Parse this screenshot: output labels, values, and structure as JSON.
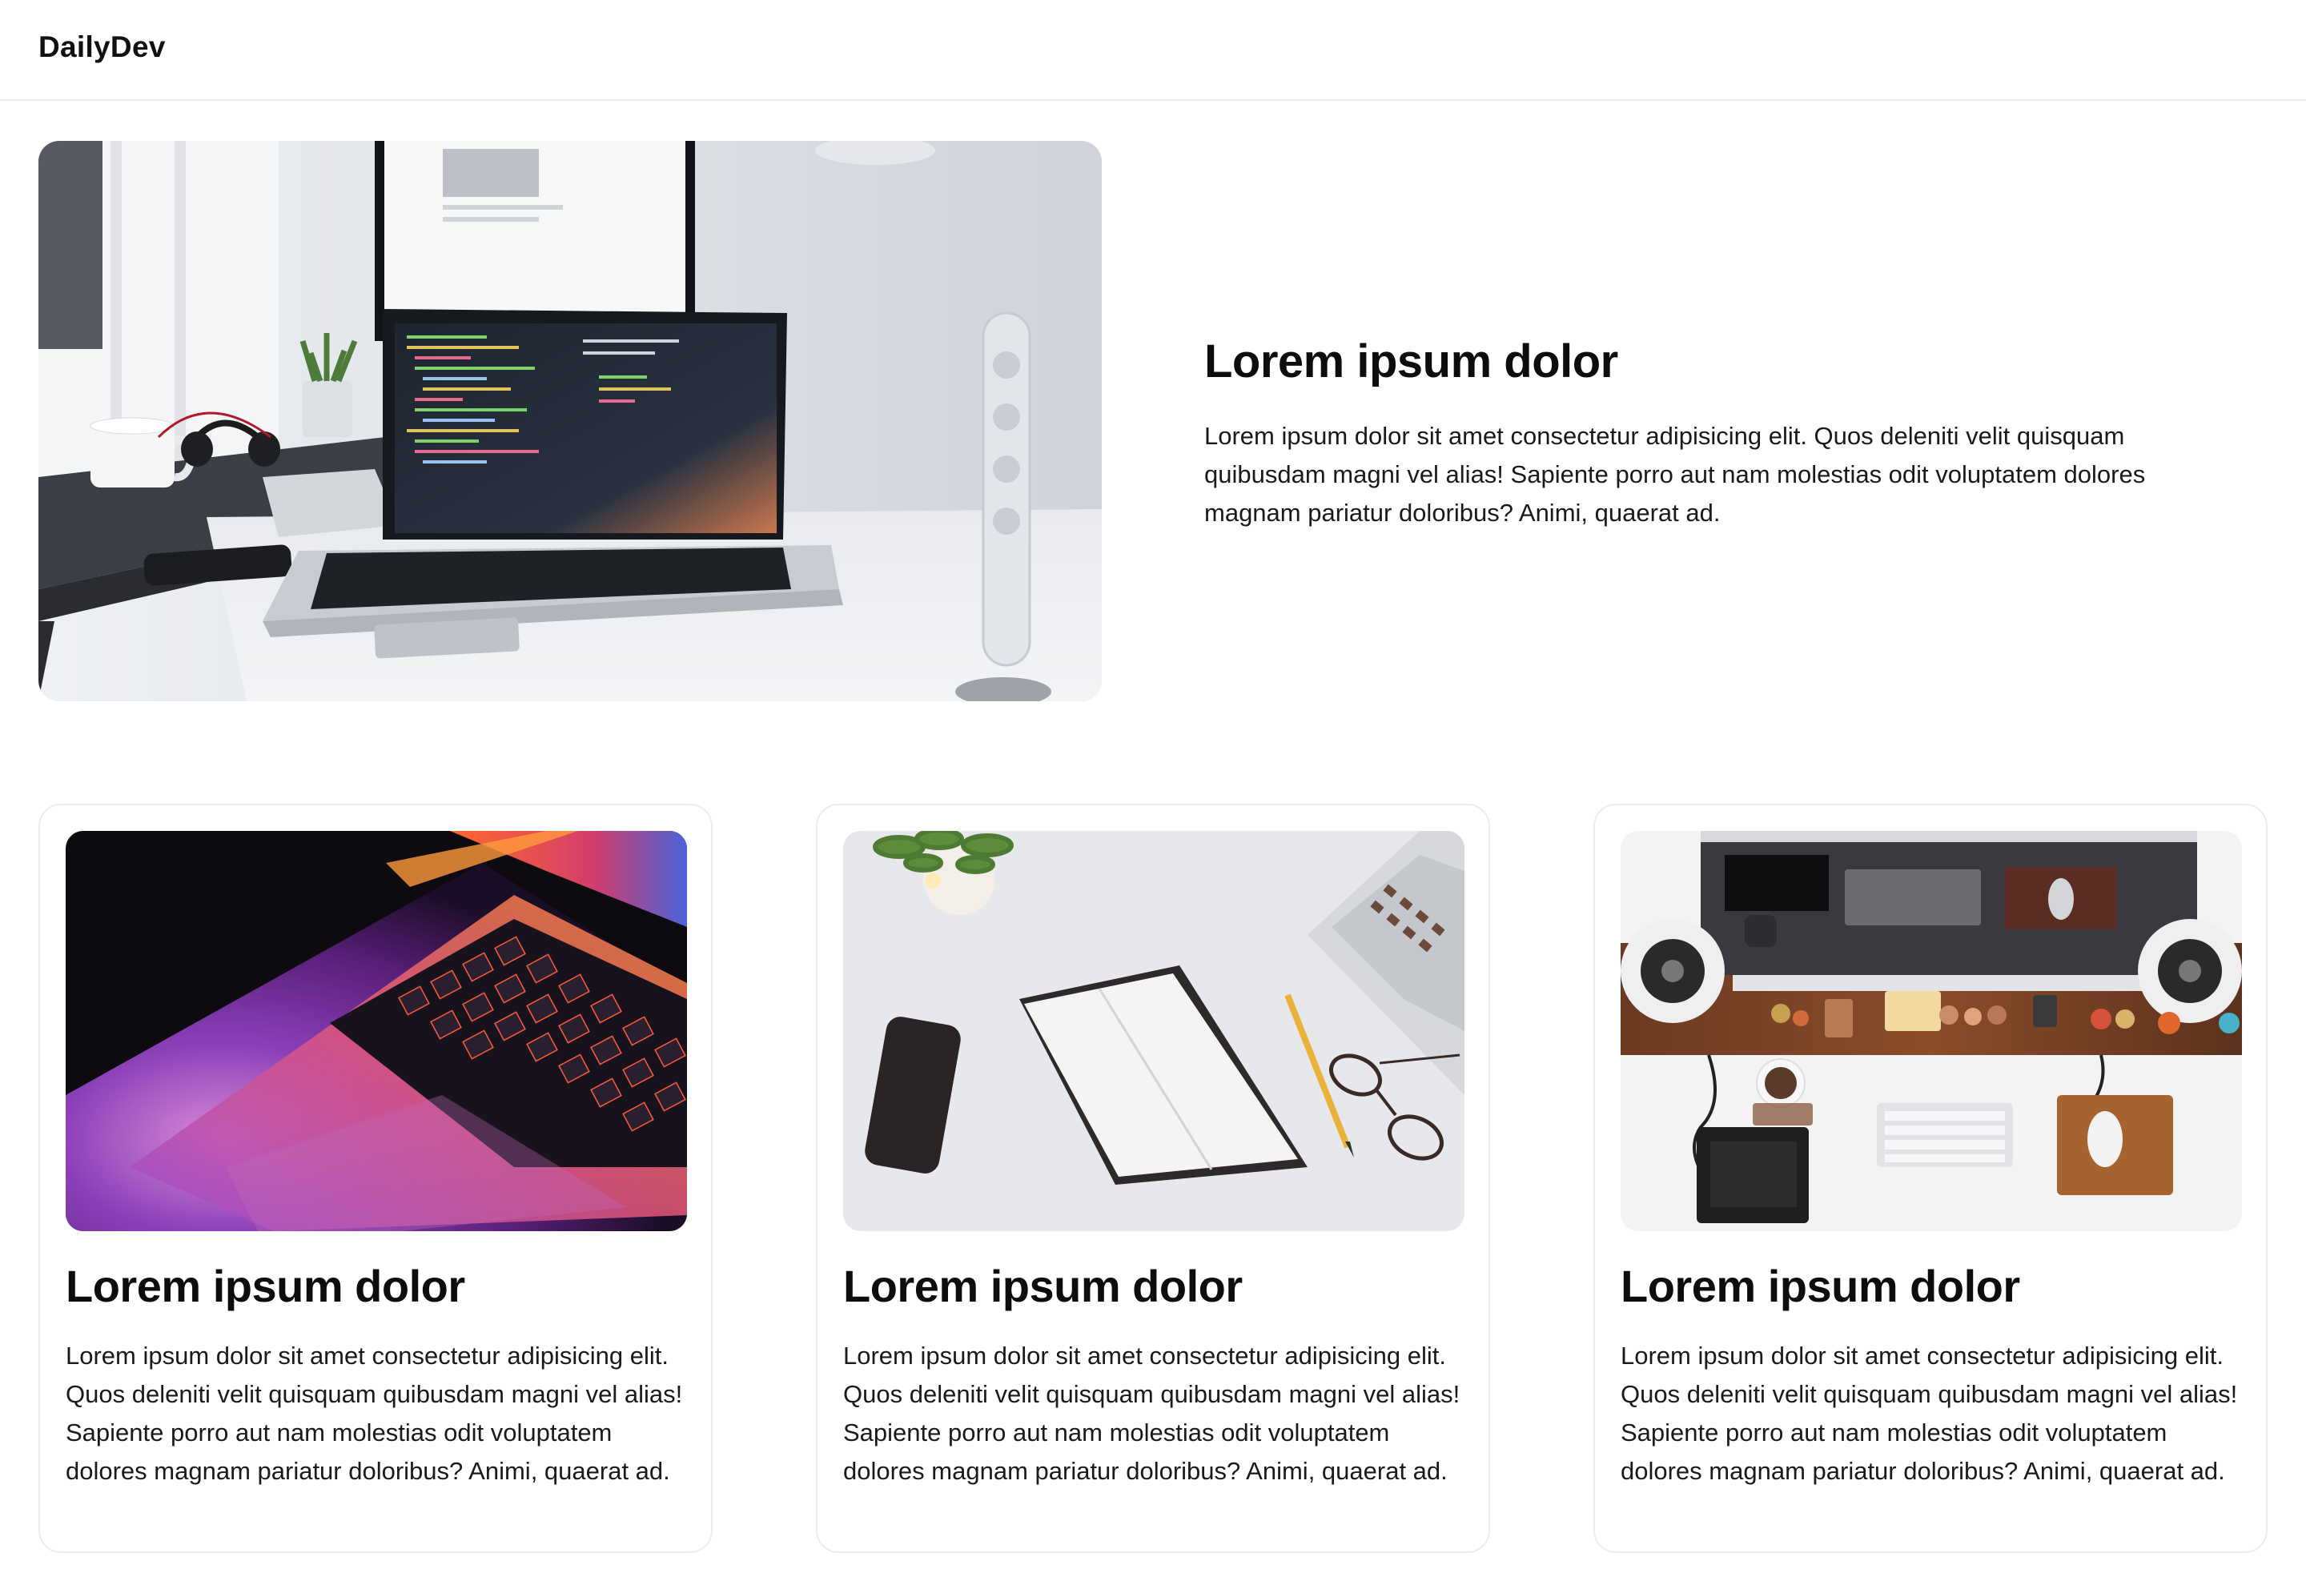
{
  "navbar": {
    "brand": "DailyDev"
  },
  "hero": {
    "image_alt": "laptop-on-desk-photo",
    "title": "Lorem ipsum dolor",
    "description": "Lorem ipsum dolor sit amet consectetur adipisicing elit. Quos deleniti velit quisquam quibusdam magni vel alias! Sapiente porro aut nam molestias odit voluptatem dolores magnam pariatur doloribus? Animi, quaerat ad."
  },
  "cards": [
    {
      "image_alt": "backlit-laptop-keyboard-photo",
      "title": "Lorem ipsum dolor",
      "description": "Lorem ipsum dolor sit amet consectetur adipisicing elit. Quos deleniti velit quisquam quibusdam magni vel alias! Sapiente porro aut nam molestias odit voluptatem dolores magnam pariatur doloribus? Animi, quaerat ad."
    },
    {
      "image_alt": "notebook-and-phone-photo",
      "title": "Lorem ipsum dolor",
      "description": "Lorem ipsum dolor sit amet consectetur adipisicing elit. Quos deleniti velit quisquam quibusdam magni vel alias! Sapiente porro aut nam molestias odit voluptatem dolores magnam pariatur doloribus? Animi, quaerat ad."
    },
    {
      "image_alt": "desk-setup-top-view-photo",
      "title": "Lorem ipsum dolor",
      "description": "Lorem ipsum dolor sit amet consectetur adipisicing elit. Quos deleniti velit quisquam quibusdam magni vel alias! Sapiente porro aut nam molestias odit voluptatem dolores magnam pariatur doloribus? Animi, quaerat ad."
    }
  ]
}
